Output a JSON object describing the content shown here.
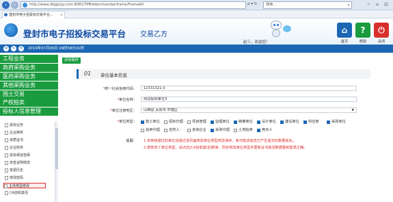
{
  "browser": {
    "url": "http://www.dfggzyjy.com:8081/TPBidder/memberframe/FrameAll",
    "tools": "ρ ▾ ↻",
    "search_placeholder": "搜索...",
    "tab_title": "登封市电子招投标交易平台...",
    "window_controls": "☆ ⌂ ☺"
  },
  "header": {
    "title": "登封市电子招投标交易平台",
    "subtitle": "交易乙方",
    "welcome": "赵三，欢迎您！",
    "buttons": [
      {
        "label": "首页",
        "glyph": "⌂",
        "color": "#1c67b4"
      },
      {
        "label": "帮助",
        "glyph": "?",
        "color": "#1a9c3e"
      },
      {
        "label": "关闭",
        "glyph": "⏻",
        "color": "#d9302c"
      }
    ]
  },
  "status": {
    "datetime": "2019年07月09日 09时58分41秒",
    "icon_glyphs": [
      "✉",
      "✎",
      "☰"
    ]
  },
  "menu": {
    "items": [
      "工程业务",
      "政府采购业务",
      "医药采购业务",
      "其他采购业务",
      "国土交易",
      "产权拍卖",
      "投标人信息管理"
    ]
  },
  "tree": {
    "items": [
      "投标业务",
      "企业荣奖",
      "资质证书",
      "企业财务",
      "投标保证担保",
      "未签证明修改",
      "变更历史",
      "修改密码",
      "主体类型修改",
      "CA自助激活"
    ],
    "active_index": 8
  },
  "toolbar": {
    "save_label": "添加保存"
  },
  "section": {
    "number": "01",
    "title": "单位基本信息"
  },
  "form": {
    "credit_code_label": "统一社会信用代码：",
    "credit_code_value": "12331321-3",
    "unit_name_label": "单位名称：",
    "unit_name_value": "测试投标单位3",
    "region_label": "单位注册地区：",
    "region_value": "山西省.太原市.市辖区",
    "unit_type_label": "单位类型：",
    "unit_types_row1": [
      {
        "label": "施工单位",
        "checked": true
      },
      {
        "label": "招标代理",
        "checked": false
      },
      {
        "label": "项目管理",
        "checked": false
      },
      {
        "label": "监理单位",
        "checked": true
      },
      {
        "label": "勘察单位",
        "checked": true
      },
      {
        "label": "设计单位",
        "checked": true
      },
      {
        "label": "建设单位",
        "checked": true
      },
      {
        "label": "供应商",
        "checked": true
      },
      {
        "label": "采购单位",
        "checked": true
      }
    ],
    "unit_types_row2": [
      {
        "label": "拍卖代理",
        "checked": false
      },
      {
        "label": "自然人",
        "checked": false
      },
      {
        "label": "咨询企业",
        "checked": false
      },
      {
        "label": "采购代理",
        "checked": true
      },
      {
        "label": "土地拍卖",
        "checked": false
      },
      {
        "label": "竞买人",
        "checked": true
      }
    ],
    "tip_label": "提醒：",
    "tips": [
      "1.未审核通过的单位请通过该页面修改单位类型修改保存，有可能该信息已产生提交的数据丢失。",
      "2.若修改了单位类型，请点击[CA自助激活]菜单，同步修改单位类型并更新证书激活数据重新登录正确。"
    ]
  }
}
